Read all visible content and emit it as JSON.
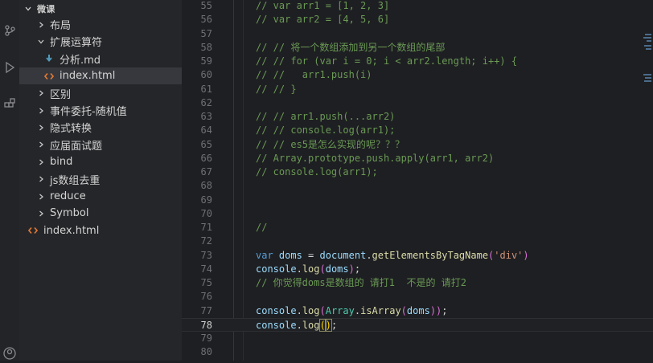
{
  "explorer": {
    "root_label": "微课",
    "items": [
      {
        "label": "布局",
        "kind": "folder",
        "expanded": false,
        "depth": 1
      },
      {
        "label": "扩展运算符",
        "kind": "folder",
        "expanded": true,
        "depth": 1
      },
      {
        "label": "分析.md",
        "kind": "md",
        "depth": 2
      },
      {
        "label": "index.html",
        "kind": "html",
        "depth": 2,
        "active": true
      },
      {
        "label": "区别",
        "kind": "folder",
        "expanded": false,
        "depth": 1
      },
      {
        "label": "事件委托-随机值",
        "kind": "folder",
        "expanded": false,
        "depth": 1
      },
      {
        "label": "隐式转换",
        "kind": "folder",
        "expanded": false,
        "depth": 1
      },
      {
        "label": "应届面试题",
        "kind": "folder",
        "expanded": false,
        "depth": 1
      },
      {
        "label": "bind",
        "kind": "folder",
        "expanded": false,
        "depth": 1
      },
      {
        "label": "js数组去重",
        "kind": "folder",
        "expanded": false,
        "depth": 1
      },
      {
        "label": "reduce",
        "kind": "folder",
        "expanded": false,
        "depth": 1
      },
      {
        "label": "Symbol",
        "kind": "folder",
        "expanded": false,
        "depth": 1
      },
      {
        "label": "index.html",
        "kind": "html",
        "depth": 0
      }
    ]
  },
  "editor": {
    "current_line": 78,
    "lines": [
      {
        "n": "55",
        "tokens": [
          [
            "c",
            "// var arr1 = [1, 2, 3]"
          ]
        ]
      },
      {
        "n": "56",
        "tokens": [
          [
            "c",
            "// var arr2 = [4, 5, 6]"
          ]
        ]
      },
      {
        "n": "57",
        "tokens": []
      },
      {
        "n": "58",
        "tokens": [
          [
            "c",
            "// // 将一个数组添加到另一个数组的尾部"
          ]
        ]
      },
      {
        "n": "59",
        "tokens": [
          [
            "c",
            "// // for (var i = 0; i < arr2.length; i++) {"
          ]
        ]
      },
      {
        "n": "60",
        "tokens": [
          [
            "c",
            "// //   arr1.push(i)"
          ]
        ]
      },
      {
        "n": "61",
        "tokens": [
          [
            "c",
            "// // }"
          ]
        ]
      },
      {
        "n": "62",
        "tokens": []
      },
      {
        "n": "63",
        "tokens": [
          [
            "c",
            "// // arr1.push(...arr2)"
          ]
        ]
      },
      {
        "n": "64",
        "tokens": [
          [
            "c",
            "// // console.log(arr1);"
          ]
        ]
      },
      {
        "n": "65",
        "tokens": [
          [
            "c",
            "// // es5是怎么实现的呢？？？"
          ]
        ]
      },
      {
        "n": "66",
        "tokens": [
          [
            "c",
            "// Array.prototype.push.apply(arr1, arr2)"
          ]
        ]
      },
      {
        "n": "67",
        "tokens": [
          [
            "c",
            "// console.log(arr1);"
          ]
        ]
      },
      {
        "n": "68",
        "tokens": []
      },
      {
        "n": "69",
        "tokens": []
      },
      {
        "n": "70",
        "tokens": []
      },
      {
        "n": "71",
        "tokens": [
          [
            "c",
            "//"
          ]
        ]
      },
      {
        "n": "72",
        "tokens": []
      },
      {
        "n": "73",
        "tokens": [
          [
            "k",
            "var"
          ],
          [
            "p",
            " "
          ],
          [
            "v",
            "doms"
          ],
          [
            "p",
            " = "
          ],
          [
            "v",
            "document"
          ],
          [
            "p",
            "."
          ],
          [
            "f",
            "getElementsByTagName"
          ],
          [
            "b",
            "("
          ],
          [
            "s",
            "'div'"
          ],
          [
            "b",
            ")"
          ]
        ]
      },
      {
        "n": "74",
        "tokens": [
          [
            "v",
            "console"
          ],
          [
            "p",
            "."
          ],
          [
            "f",
            "log"
          ],
          [
            "b",
            "("
          ],
          [
            "v",
            "doms"
          ],
          [
            "b",
            ")"
          ],
          [
            "p",
            ";"
          ]
        ]
      },
      {
        "n": "75",
        "tokens": [
          [
            "c",
            "// 你觉得doms是数组的 请打1  不是的 请打2"
          ]
        ]
      },
      {
        "n": "76",
        "tokens": []
      },
      {
        "n": "77",
        "tokens": [
          [
            "v",
            "console"
          ],
          [
            "p",
            "."
          ],
          [
            "f",
            "log"
          ],
          [
            "b",
            "("
          ],
          [
            "t",
            "Array"
          ],
          [
            "p",
            "."
          ],
          [
            "f",
            "isArray"
          ],
          [
            "b",
            "("
          ],
          [
            "v",
            "doms"
          ],
          [
            "b",
            "))"
          ],
          [
            "p",
            ";"
          ]
        ]
      },
      {
        "n": "78",
        "tokens": [
          [
            "v",
            "console"
          ],
          [
            "p",
            "."
          ],
          [
            "f",
            "log"
          ],
          [
            "h",
            "("
          ],
          [
            "h",
            ")"
          ],
          [
            "p",
            ";"
          ]
        ]
      },
      {
        "n": "79",
        "tokens": []
      },
      {
        "n": "80",
        "tokens": []
      }
    ]
  }
}
